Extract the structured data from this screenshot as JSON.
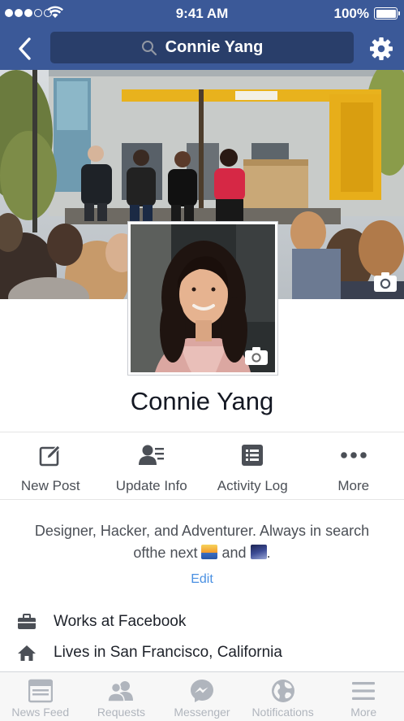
{
  "status_bar": {
    "time": "9:41 AM",
    "battery": "100%"
  },
  "search": {
    "query": "Connie Yang"
  },
  "profile": {
    "name": "Connie Yang"
  },
  "actions": [
    {
      "label": "New Post",
      "icon": "compose-icon"
    },
    {
      "label": "Update Info",
      "icon": "update-info-icon"
    },
    {
      "label": "Activity Log",
      "icon": "activity-log-icon"
    },
    {
      "label": "More",
      "icon": "more-dots-icon"
    }
  ],
  "bio": {
    "line1": "Designer, Hacker, and Adventurer. Always in search",
    "line2_a": "ofthe next",
    "line2_b": "and",
    "line2_c": ".",
    "edit": "Edit"
  },
  "info": [
    {
      "text": "Works at Facebook",
      "icon": "briefcase-icon"
    },
    {
      "text": "Lives in San Francisco, California",
      "icon": "home-icon"
    }
  ],
  "tabs": [
    {
      "label": "News Feed",
      "icon": "news-feed-icon"
    },
    {
      "label": "Requests",
      "icon": "requests-icon"
    },
    {
      "label": "Messenger",
      "icon": "messenger-icon"
    },
    {
      "label": "Notifications",
      "icon": "globe-icon"
    },
    {
      "label": "More",
      "icon": "menu-icon"
    }
  ],
  "colors": {
    "brand": "#3b5998",
    "search_bg": "#293e6a",
    "link": "#4a90e2",
    "tab_inactive": "#b0b5bd",
    "icon_gray": "#4b4f56"
  }
}
